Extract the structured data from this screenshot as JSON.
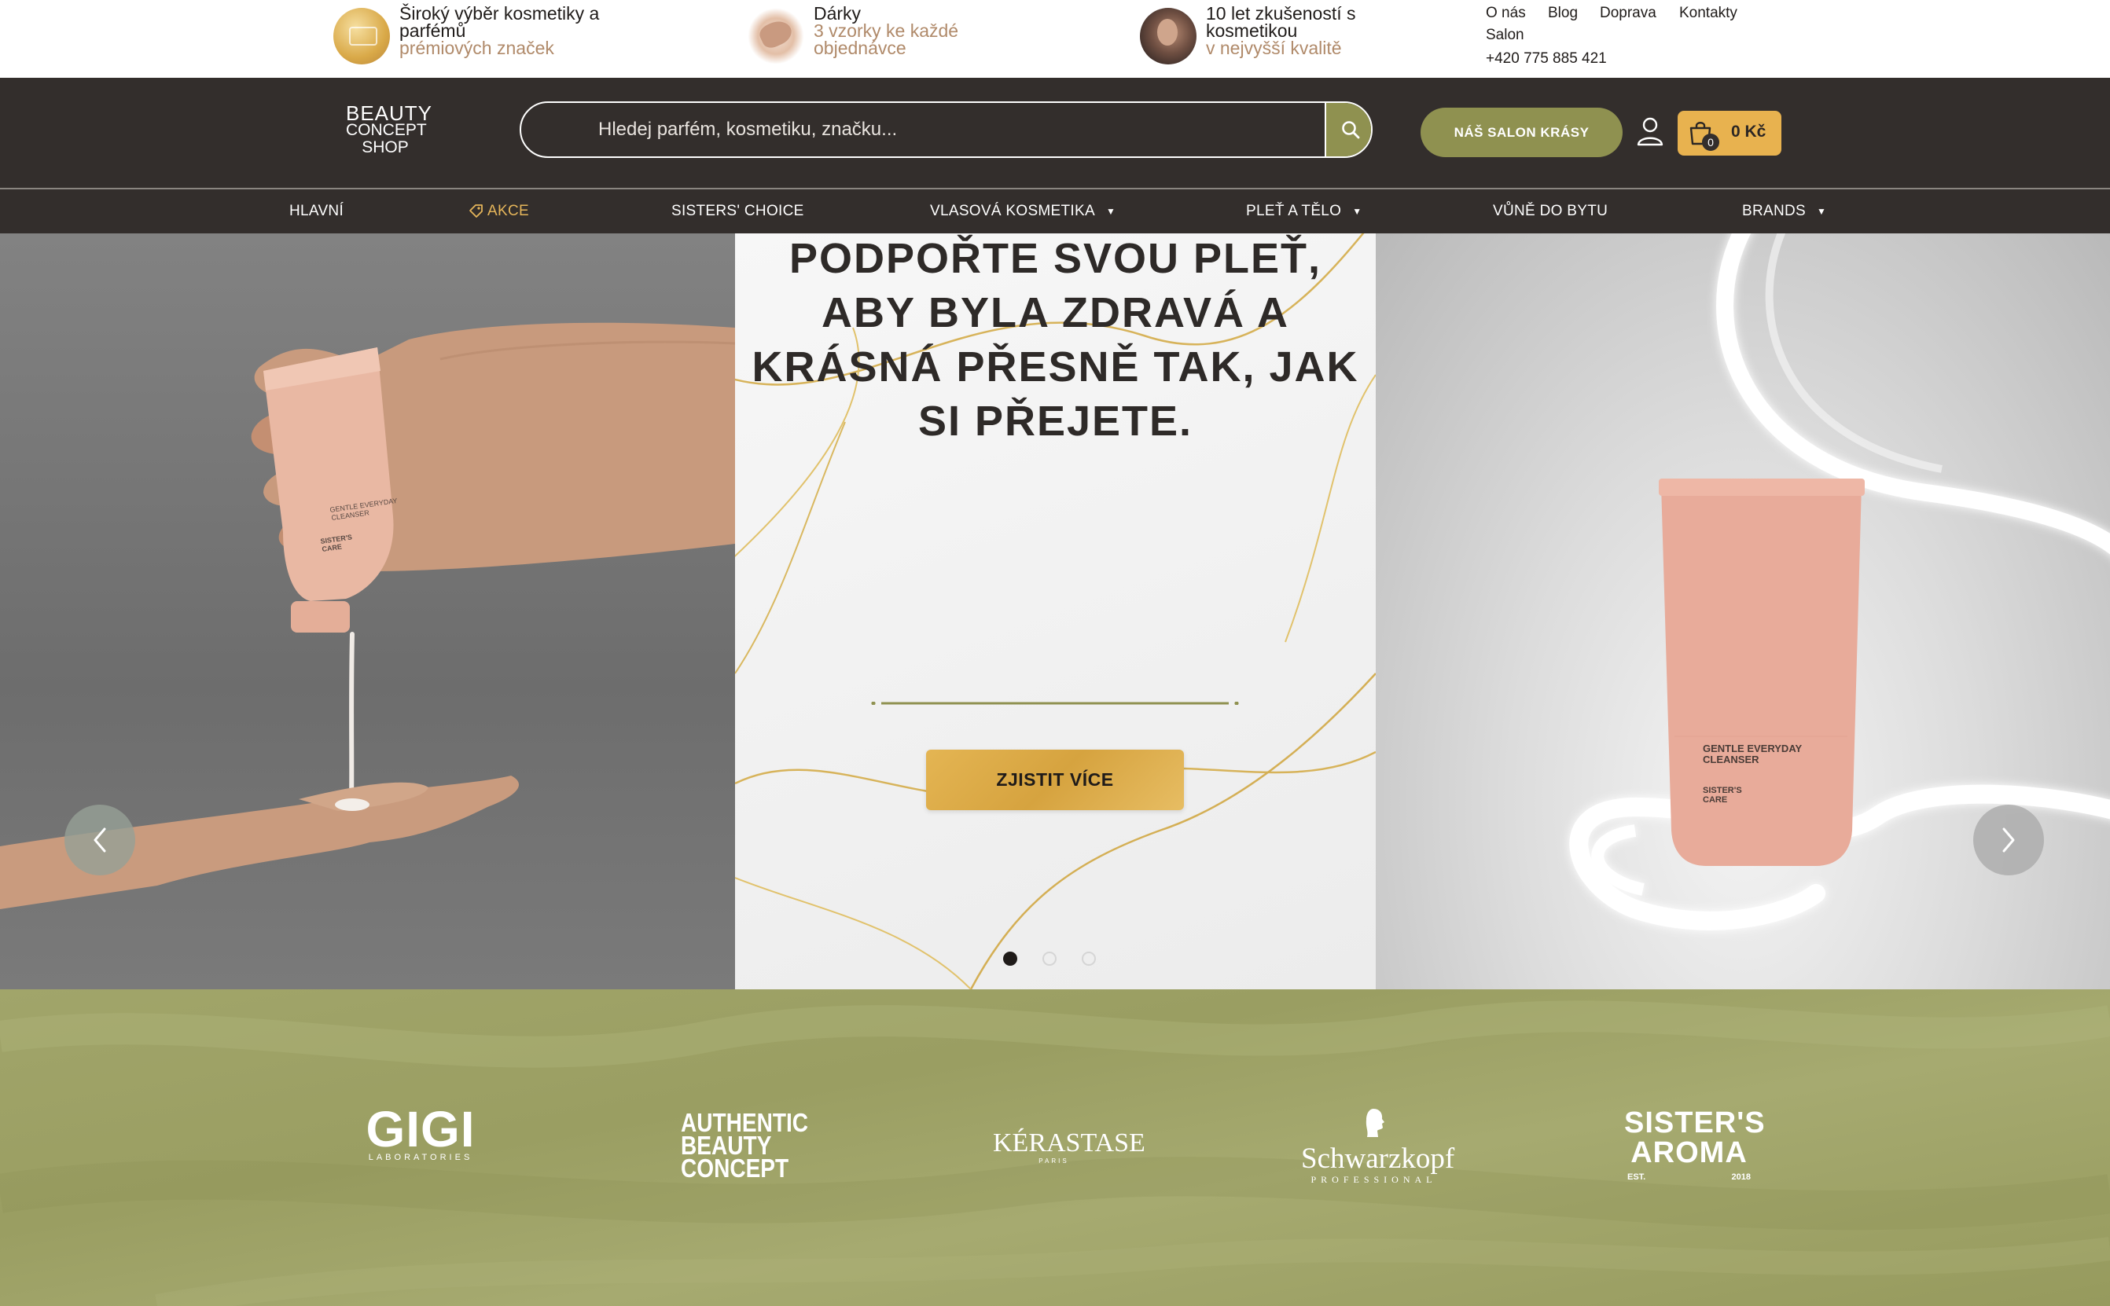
{
  "usps": [
    {
      "title": "Široký výběr kosmetiky a parfémů",
      "subtitle": "prémiových značek",
      "icon": "gift-card-thumbnail"
    },
    {
      "title": "Dárky",
      "subtitle": "3 vzorky ke každé objednávce",
      "icon": "hands-samples-thumbnail"
    },
    {
      "title": "10 let zkušeností s kosmetikou",
      "subtitle": "v nejvyšší kvalitě",
      "icon": "woman-portrait-thumbnail"
    }
  ],
  "top_links": {
    "o_nas": "O nás",
    "blog": "Blog",
    "doprava": "Doprava",
    "kontakty": "Kontakty",
    "salon": "Salon",
    "phone": "+420 775 885 421"
  },
  "logo": {
    "line1": "BEAUTY",
    "line2": "CONCEPT",
    "line3": "SHOP"
  },
  "search": {
    "placeholder": "Hledej parfém, kosmetiku, značku...",
    "icon": "search-icon"
  },
  "header": {
    "salon_button": "NÁŠ SALON KRÁSY",
    "cart_count": "0",
    "cart_price": "0 Kč"
  },
  "nav": {
    "items": [
      {
        "label": "HLAVNÍ",
        "dropdown": false
      },
      {
        "label": "AKCE",
        "dropdown": false
      },
      {
        "label": "SISTERS' CHOICE",
        "dropdown": false
      },
      {
        "label": "VLASOVÁ KOSMETIKA",
        "dropdown": true
      },
      {
        "label": "PLEŤ A TĚLO",
        "dropdown": true
      },
      {
        "label": "VŮNĚ DO BYTU",
        "dropdown": true
      },
      {
        "label": "BRANDS",
        "dropdown": true
      }
    ]
  },
  "hero": {
    "title_lines": [
      "PODPOŘTE SVOU PLEŤ,",
      "ABY BYLA ZDRAVÁ A",
      "KRÁSNÁ PŘESNĚ TAK, JAK",
      "SI PŘEJETE."
    ],
    "cta": "ZJISTIT VÍCE",
    "product_text": {
      "line1": "GENTLE EVERYDAY",
      "line2": "CLEANSER",
      "line3": "SISTER'S",
      "line4": "CARE"
    },
    "slides_total": 3,
    "active_slide": 1
  },
  "brands": {
    "gigi": {
      "name": "GIGI",
      "sub": "LABORATORIES"
    },
    "abc": {
      "line1": "AUTHENTIC",
      "line2": "BEAUTY",
      "line3": "CONCEPT"
    },
    "kerastase": {
      "name": "KÉRASTASE",
      "sub": "PARIS"
    },
    "schwarzkopf": {
      "name": "Schwarzkopf",
      "sub": "PROFESSIONAL"
    },
    "sisters": {
      "line1": "SISTER'S",
      "line2": "AROMA",
      "est": "EST.",
      "year": "2018"
    }
  },
  "colors": {
    "header_bg": "#332e2c",
    "accent_olive": "#8f9150",
    "accent_gold": "#e8b24f",
    "brand_strip": "#9fa366"
  }
}
